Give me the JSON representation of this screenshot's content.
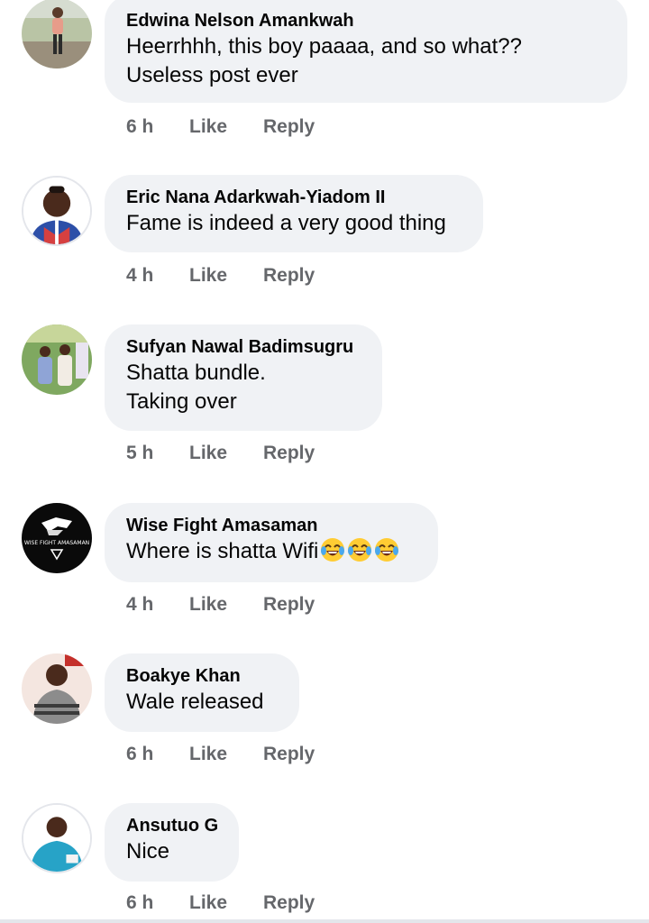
{
  "comments": [
    {
      "author": "Edwina Nelson Amankwah",
      "lines": [
        "Heerrhhh, this boy paaaa, and so what??",
        "Useless post ever"
      ],
      "time": "6 h",
      "like": "Like",
      "reply": "Reply"
    },
    {
      "author": "Eric Nana Adarkwah-Yiadom II",
      "lines": [
        "Fame is indeed a very good thing"
      ],
      "time": "4 h",
      "like": "Like",
      "reply": "Reply"
    },
    {
      "author": "Sufyan Nawal Badimsugru",
      "lines": [
        "Shatta bundle.",
        "Taking over"
      ],
      "time": "5 h",
      "like": "Like",
      "reply": "Reply"
    },
    {
      "author": "Wise Fight Amasaman",
      "lines": [
        "Where is shatta Wifi"
      ],
      "emoji": [
        "tears-of-joy-emoji",
        "tears-of-joy-emoji",
        "tears-of-joy-emoji"
      ],
      "time": "4 h",
      "like": "Like",
      "reply": "Reply",
      "avatar_logo_text": "WISE FIGHT AMASAMAN"
    },
    {
      "author": "Boakye Khan",
      "lines": [
        "Wale released"
      ],
      "time": "6 h",
      "like": "Like",
      "reply": "Reply"
    },
    {
      "author": "Ansutuo G",
      "lines": [
        "Nice"
      ],
      "time": "6 h",
      "like": "Like",
      "reply": "Reply"
    }
  ],
  "colors": {
    "bubble": "#f0f2f5",
    "author_text": "#050505",
    "meta_text": "#65676b"
  }
}
